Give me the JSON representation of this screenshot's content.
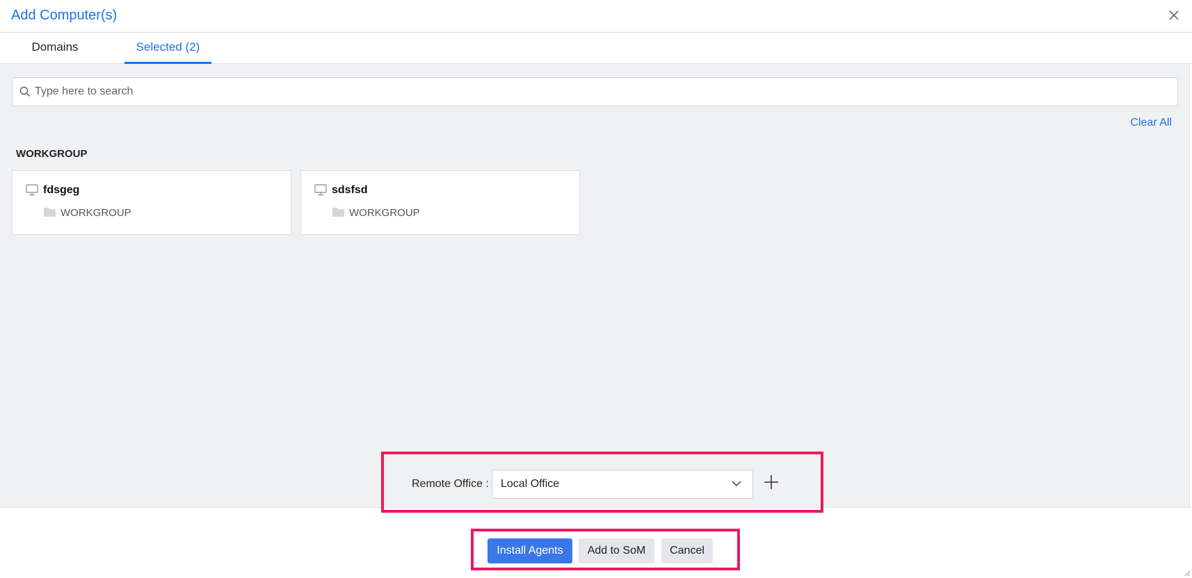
{
  "dialog": {
    "title": "Add Computer(s)"
  },
  "tabs": [
    {
      "label": "Domains"
    },
    {
      "label": "Selected (2)"
    }
  ],
  "search": {
    "placeholder": "Type here to search"
  },
  "clear_all_label": "Clear All",
  "group": {
    "title": "WORKGROUP",
    "computers": [
      {
        "name": "fdsgeg",
        "domain": "WORKGROUP"
      },
      {
        "name": "sdsfsd",
        "domain": "WORKGROUP"
      }
    ]
  },
  "remote_office": {
    "label": "Remote Office :",
    "selected": "Local Office"
  },
  "footer": {
    "install_label": "Install Agents",
    "add_som_label": "Add to SoM",
    "cancel_label": "Cancel"
  },
  "colors": {
    "accent": "#1a73e8",
    "primary_button": "#3b78e7",
    "highlight": "#ea1a5d"
  }
}
